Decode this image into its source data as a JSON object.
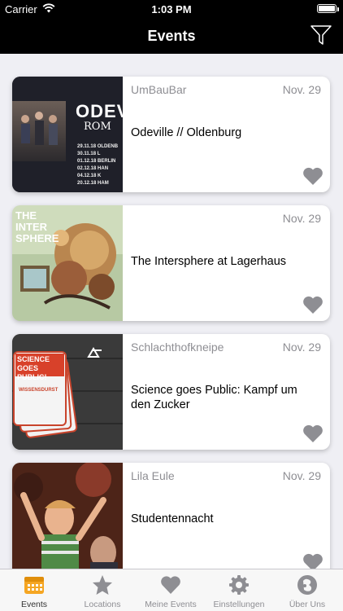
{
  "status": {
    "carrier": "Carrier",
    "time": "1:03 PM"
  },
  "nav": {
    "title": "Events"
  },
  "events": [
    {
      "venue": "UmBauBar",
      "date": "Nov. 29",
      "name": "Odeville // Oldenburg",
      "poster_title": "ODEVI",
      "poster_subtitle": "ROM",
      "poster_dates": [
        "29.11.18 OLDENB",
        "30.11.18 L",
        "01.12.18 BERLIN",
        "02.12.18 HAN",
        "04.12.18 K",
        "20.12.18 HAM"
      ]
    },
    {
      "venue": "",
      "date": "Nov. 29",
      "name": "The Intersphere at Lagerhaus",
      "poster_title": "THE INTER SPHERE"
    },
    {
      "venue": "Schlachthofkneipe",
      "date": "Nov. 29",
      "name": "Science goes Public: Kampf um den Zucker",
      "poster_title": "SCIENCE GOES PUBLIC!",
      "poster_subtitle": "WISSENSDURST"
    },
    {
      "venue": "Lila Eule",
      "date": "Nov. 29",
      "name": "Studentennacht"
    }
  ],
  "tabs": [
    {
      "label": "Events",
      "icon": "calendar-icon"
    },
    {
      "label": "Locations",
      "icon": "star-icon"
    },
    {
      "label": "Meine Events",
      "icon": "heart-icon"
    },
    {
      "label": "Einstellungen",
      "icon": "gear-icon"
    },
    {
      "label": "Über Uns",
      "icon": "info-icon"
    }
  ],
  "colors": {
    "accent": "#f5a623",
    "tab_inactive": "#8e8e93",
    "heart": "#8e8e93"
  }
}
